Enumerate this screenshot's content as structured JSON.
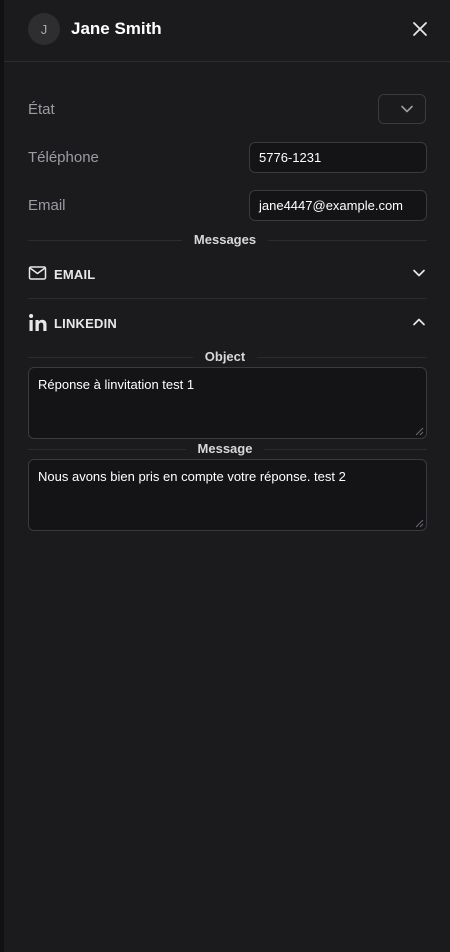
{
  "header": {
    "avatar_initial": "J",
    "title": "Jane Smith"
  },
  "fields": {
    "state_label": "État",
    "phone_label": "Téléphone",
    "phone_value": "5776-1231",
    "email_label": "Email",
    "email_value": "jane4447@example.com"
  },
  "messages": {
    "section_title": "Messages",
    "email_label": "EMAIL",
    "linkedin_label": "LINKEDIN",
    "object_title": "Object",
    "object_value": "Réponse à linvitation test 1",
    "message_title": "Message",
    "message_value": "Nous avons bien pris en compte votre réponse. test 2"
  },
  "icons": {
    "close": "close-icon",
    "select_chevron": "chevron-down-icon",
    "email": "mail-icon",
    "linkedin": "linkedin-icon",
    "email_chevron": "chevron-down-icon",
    "linkedin_chevron": "chevron-up-icon"
  },
  "colors": {
    "background": "#1b1b1d",
    "border": "#3a3a3f",
    "muted_text": "#9b9ba3"
  }
}
